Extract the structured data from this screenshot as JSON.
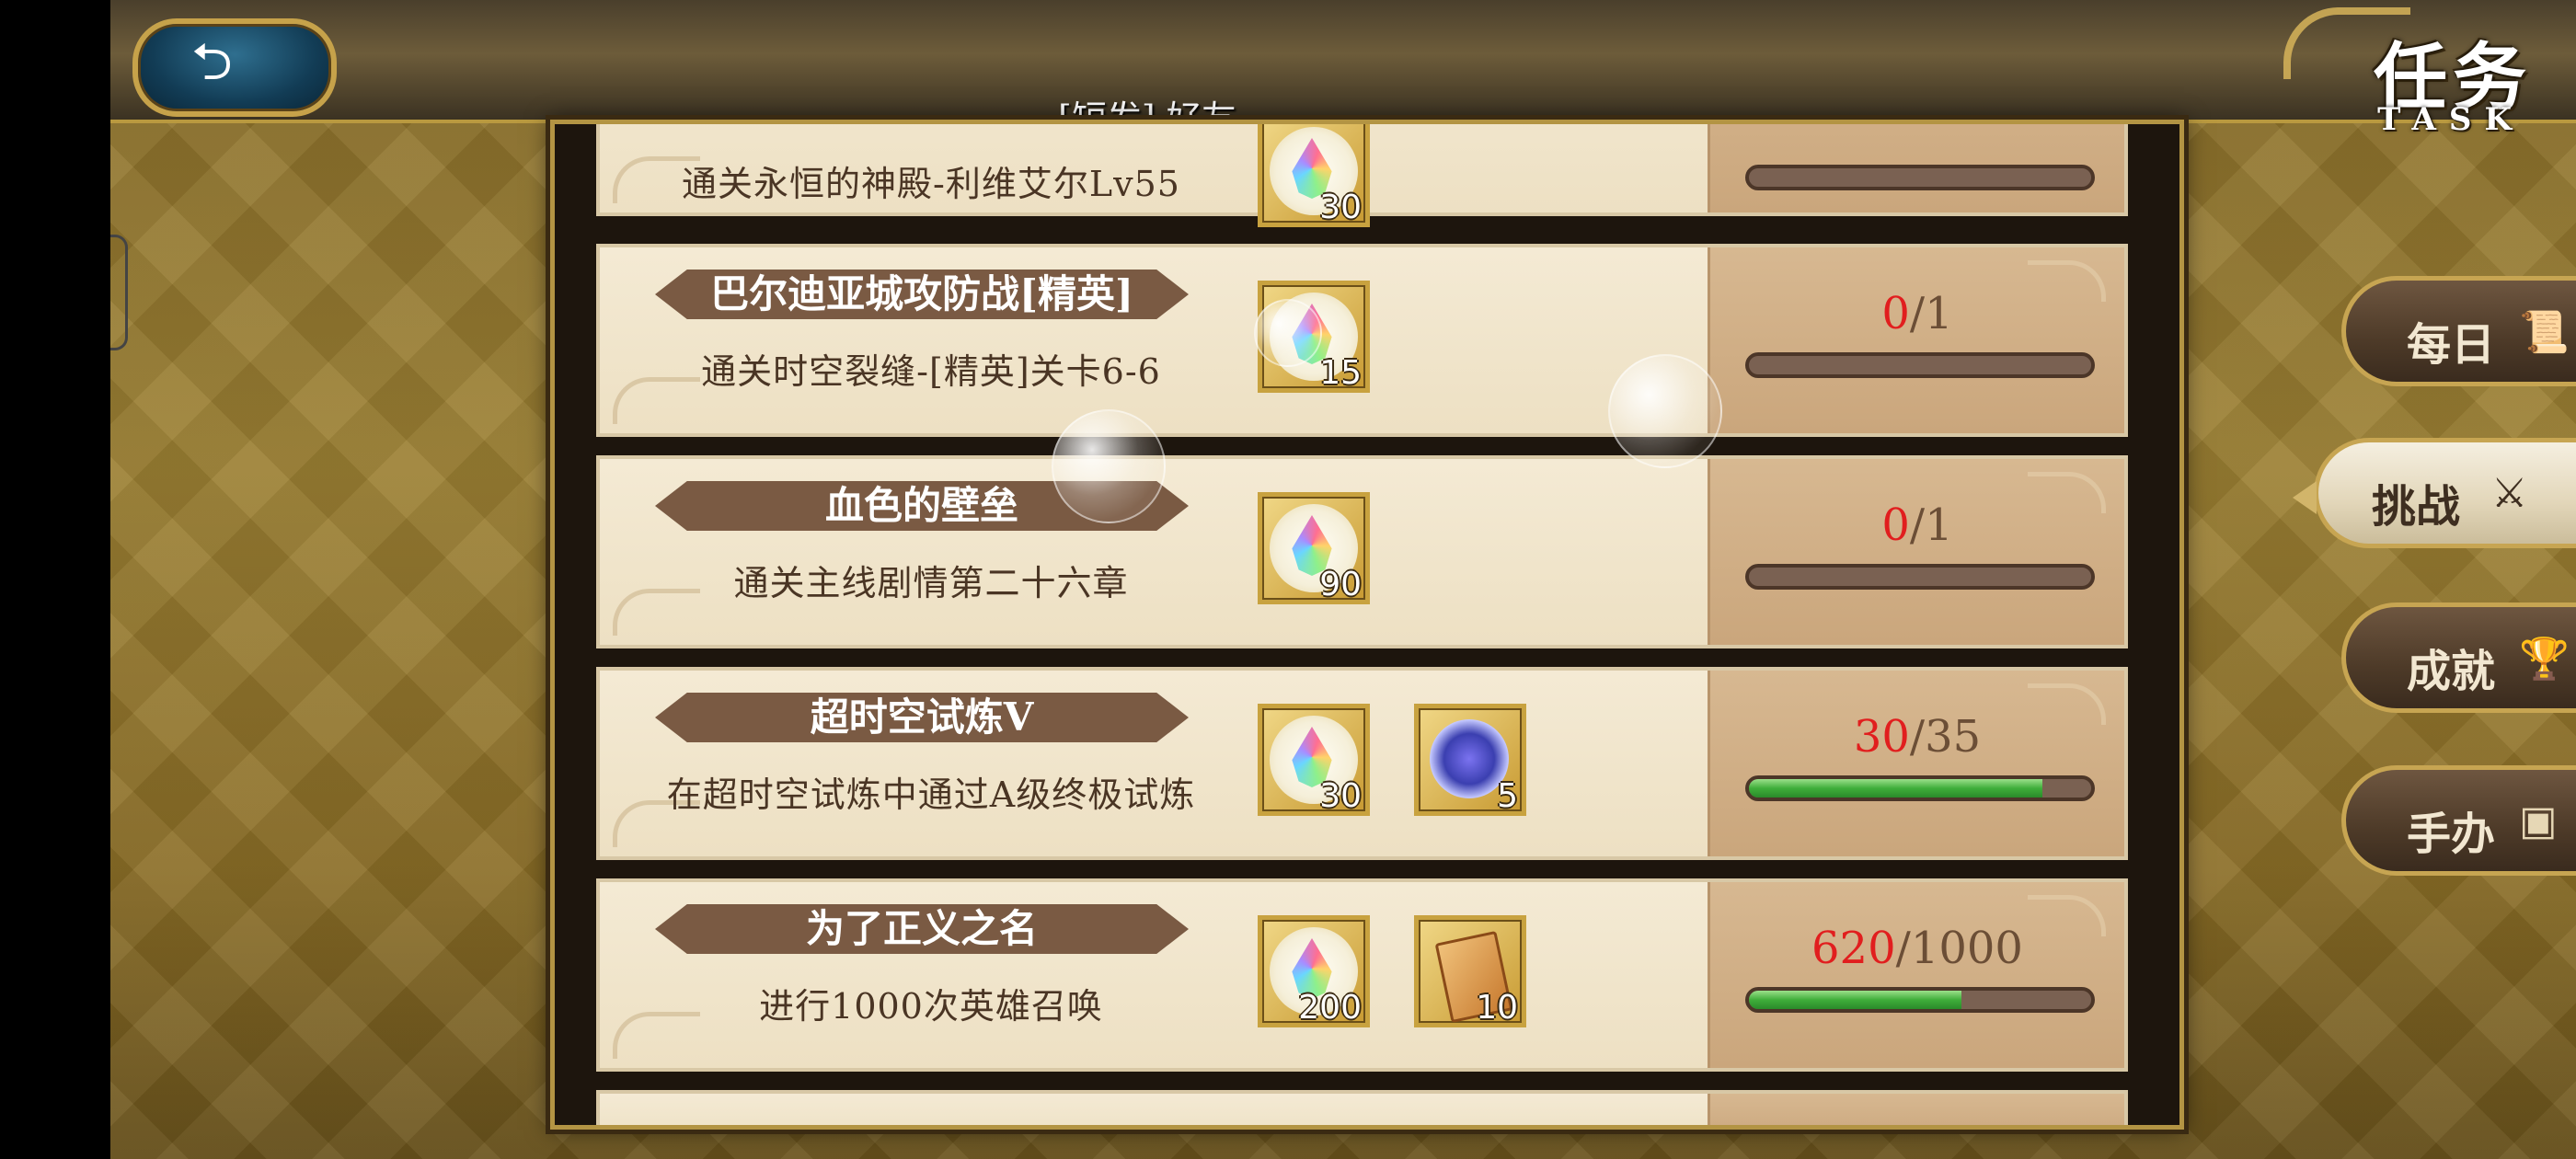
{
  "header": {
    "back_icon": "back-arrow-icon",
    "title_cn": "任务",
    "title_en": "TASK",
    "friend_label": "[短发] 好友"
  },
  "tasks": [
    {
      "title": "",
      "desc": "通关永恒的神殿-利维艾尔Lv55",
      "rewards": [
        {
          "icon": "rainbow-gem-icon",
          "count": "30"
        }
      ],
      "current": "",
      "target": "",
      "progress": 0.0
    },
    {
      "title": "巴尔迪亚城攻防战[精英]",
      "desc": "通关时空裂缝-[精英]关卡6-6",
      "rewards": [
        {
          "icon": "rainbow-gem-icon",
          "count": "15"
        }
      ],
      "current": "0",
      "target": "/1",
      "progress": 0.0
    },
    {
      "title": "血色的壁垒",
      "desc": "通关主线剧情第二十六章",
      "rewards": [
        {
          "icon": "rainbow-gem-icon",
          "count": "90"
        }
      ],
      "current": "0",
      "target": "/1",
      "progress": 0.0
    },
    {
      "title": "超时空试炼V",
      "desc": "在超时空试炼中通过A级终极试炼",
      "rewards": [
        {
          "icon": "rainbow-gem-icon",
          "count": "30"
        },
        {
          "icon": "blue-crystal-fragment-icon",
          "count": "5"
        }
      ],
      "current": "30",
      "target": "/35",
      "progress": 0.857
    },
    {
      "title": "为了正义之名",
      "desc": "进行1000次英雄召唤",
      "rewards": [
        {
          "icon": "rainbow-gem-icon",
          "count": "200"
        },
        {
          "icon": "summon-ticket-icon",
          "count": "10"
        }
      ],
      "current": "620",
      "target": "/1000",
      "progress": 0.62
    }
  ],
  "tabs": [
    {
      "label": "每日",
      "icon": "scroll-icon",
      "active": false
    },
    {
      "label": "挑战",
      "icon": "crossed-swords-icon",
      "active": true
    },
    {
      "label": "成就",
      "icon": "trophy-icon",
      "active": false
    },
    {
      "label": "手办",
      "icon": "figure-box-icon",
      "active": false
    }
  ],
  "colors": {
    "progress_current": "#e11e1e",
    "progress_fill": "#3fae3a",
    "frame_gold": "#c7a552"
  }
}
